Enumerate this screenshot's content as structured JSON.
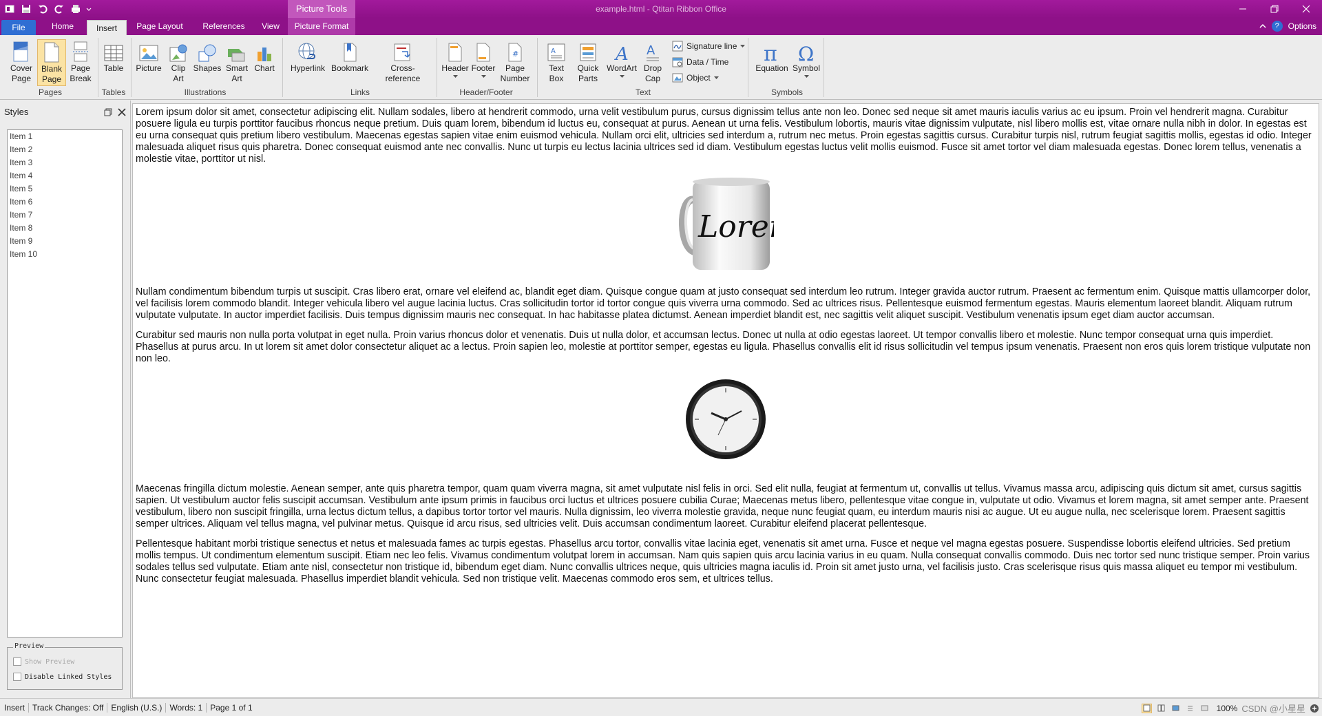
{
  "window": {
    "title": "example.html - Qtitan Ribbon Office",
    "contextual_tab_group": "Picture Tools"
  },
  "tabs": [
    {
      "label": "File"
    },
    {
      "label": "Home"
    },
    {
      "label": "Insert",
      "selected": true
    },
    {
      "label": "Page Layout"
    },
    {
      "label": "References"
    },
    {
      "label": "View"
    },
    {
      "label": "Picture Format"
    }
  ],
  "tabbar_right": {
    "options_label": "Options",
    "help_glyph": "?"
  },
  "ribbon": {
    "pages": {
      "label": "Pages",
      "cover_page": "Cover Page",
      "blank_page": "Blank Page",
      "page_break": "Page Break"
    },
    "tables": {
      "label": "Tables",
      "table": "Table"
    },
    "illustrations": {
      "label": "Illustrations",
      "picture": "Picture",
      "clip_art": "Clip Art",
      "shapes": "Shapes",
      "smart_art": "Smart Art",
      "chart": "Chart"
    },
    "links": {
      "label": "Links",
      "hyperlink": "Hyperlink",
      "bookmark": "Bookmark",
      "cross_reference": "Cross-reference"
    },
    "header_footer": {
      "label": "Header/Footer",
      "header": "Header",
      "footer": "Footer",
      "page_number": "Page Number"
    },
    "text": {
      "label": "Text",
      "text_box": "Text Box",
      "quick_parts": "Quick Parts",
      "wordart": "WordArt",
      "drop_cap": "Drop Cap",
      "signature_line": "Signature line",
      "date_time": "Data / Time",
      "object": "Object"
    },
    "symbols": {
      "label": "Symbols",
      "equation": "Equation",
      "symbol": "Symbol"
    }
  },
  "styles_pane": {
    "title": "Styles",
    "items": [
      "Item 1",
      "Item 2",
      "Item 3",
      "Item 4",
      "Item 5",
      "Item 6",
      "Item 7",
      "Item 8",
      "Item 9",
      "Item 10"
    ],
    "preview_legend": "Preview",
    "show_preview": "Show Preview",
    "disable_linked": "Disable Linked Styles"
  },
  "document": {
    "p1": "Lorem ipsum dolor sit amet, consectetur adipiscing elit. Nullam sodales, libero at hendrerit commodo, urna velit vestibulum purus, cursus dignissim tellus ante non leo. Donec sed neque sit amet mauris iaculis varius ac eu ipsum. Proin vel hendrerit magna. Curabitur posuere ligula eu turpis porttitor faucibus rhoncus neque pretium. Duis quam lorem, bibendum id luctus eu, consequat at purus. Aenean ut urna felis. Vestibulum lobortis, mauris vitae dignissim vulputate, nisl libero mollis est, vitae ornare nulla nibh in dolor. In egestas est eu urna consequat quis pretium libero vestibulum. Maecenas egestas sapien vitae enim euismod vehicula. Nullam orci elit, ultricies sed interdum a, rutrum nec metus. Proin egestas sagittis cursus. Curabitur turpis nisl, rutrum feugiat sagittis mollis, egestas id odio. Integer malesuada aliquet risus quis pharetra. Donec consequat euismod ante nec convallis. Nunc ut turpis eu lectus lacinia ultrices sed id diam. Vestibulum egestas luctus velit mollis euismod. Fusce sit amet tortor vel diam malesuada egestas. Donec lorem tellus, venenatis a molestie vitae, porttitor ut nisl.",
    "mug_text": "Lorem",
    "p2": "Nullam condimentum bibendum turpis ut suscipit. Cras libero erat, ornare vel eleifend ac, blandit eget diam. Quisque congue quam at justo consequat sed interdum leo rutrum. Integer gravida auctor rutrum. Praesent ac fermentum enim. Quisque mattis ullamcorper dolor, vel facilisis lorem commodo blandit. Integer vehicula libero vel augue lacinia luctus. Cras sollicitudin tortor id tortor congue quis viverra urna commodo. Sed ac ultrices risus. Pellentesque euismod fermentum egestas. Mauris elementum laoreet blandit. Aliquam rutrum vulputate vulputate. In auctor imperdiet facilisis. Duis tempus dignissim mauris nec consequat. In hac habitasse platea dictumst. Aenean imperdiet blandit est, nec sagittis velit aliquet suscipit. Vestibulum venenatis ipsum eget diam auctor accumsan.",
    "p3": "Curabitur sed mauris non nulla porta volutpat in eget nulla. Proin varius rhoncus dolor et venenatis. Duis ut nulla dolor, et accumsan lectus. Donec ut nulla at odio egestas laoreet. Ut tempor convallis libero et molestie. Nunc tempor consequat urna quis imperdiet. Phasellus at purus arcu. In ut lorem sit amet dolor consectetur aliquet ac a lectus. Proin sapien leo, molestie at porttitor semper, egestas eu ligula. Phasellus convallis elit id risus sollicitudin vel tempus ipsum venenatis. Praesent non eros quis lorem tristique vulputate non non leo.",
    "p4": "Maecenas fringilla dictum molestie. Aenean semper, ante quis pharetra tempor, quam quam viverra magna, sit amet vulputate nisl felis in orci. Sed elit nulla, feugiat at fermentum ut, convallis ut tellus. Vivamus massa arcu, adipiscing quis dictum sit amet, cursus sagittis sapien. Ut vestibulum auctor felis suscipit accumsan. Vestibulum ante ipsum primis in faucibus orci luctus et ultrices posuere cubilia Curae; Maecenas metus libero, pellentesque vitae congue in, vulputate ut odio. Vivamus et lorem magna, sit amet semper ante. Praesent vestibulum, libero non suscipit fringilla, urna lectus dictum tellus, a dapibus tortor tortor vel mauris. Nulla dignissim, leo viverra molestie gravida, neque nunc feugiat quam, eu interdum mauris nisi ac augue. Ut eu augue nulla, nec scelerisque lorem. Praesent sagittis semper ultrices. Aliquam vel tellus magna, vel pulvinar metus. Quisque id arcu risus, sed ultricies velit. Duis accumsan condimentum laoreet. Curabitur eleifend placerat pellentesque.",
    "p5": "Pellentesque habitant morbi tristique senectus et netus et malesuada fames ac turpis egestas. Phasellus arcu tortor, convallis vitae lacinia eget, venenatis sit amet urna. Fusce et neque vel magna egestas posuere. Suspendisse lobortis eleifend ultricies. Sed pretium mollis tempus. Ut condimentum elementum suscipit. Etiam nec leo felis. Vivamus condimentum volutpat lorem in accumsan. Nam quis sapien quis arcu lacinia varius in eu quam. Nulla consequat convallis commodo. Duis nec tortor sed nunc tristique semper. Proin varius sodales tellus sed vulputate. Etiam ante nisl, consectetur non tristique id, bibendum eget diam. Nunc convallis ultrices neque, quis ultricies magna iaculis id. Proin sit amet justo urna, vel facilisis justo. Cras scelerisque risus quis massa aliquet eu tempor mi vestibulum. Nunc consectetur feugiat malesuada. Phasellus imperdiet blandit vehicula. Sed non tristique velit. Maecenas commodo eros sem, et ultrices tellus."
  },
  "statusbar": {
    "mode": "Insert",
    "track_changes": "Track Changes: Off",
    "language": "English (U.S.)",
    "words": "Words: 1",
    "page": "Page 1 of 1",
    "zoom": "100%",
    "watermark": "CSDN @小星星"
  },
  "colors": {
    "titlebar": "#8e1188",
    "file_tab": "#2f6ed3",
    "active_button": "#fbe3a4"
  }
}
